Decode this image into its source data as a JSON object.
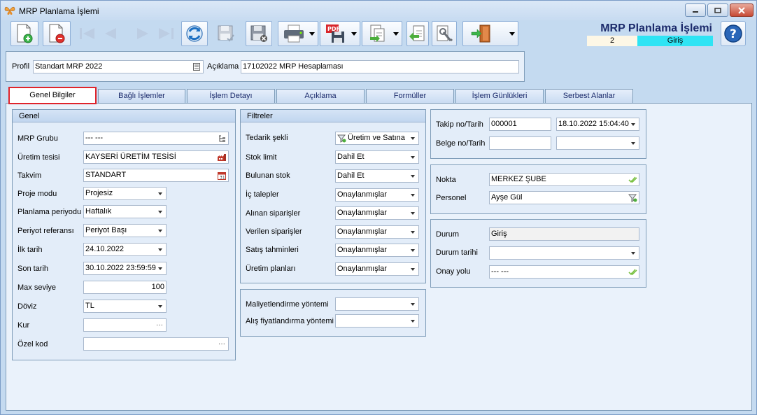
{
  "window": {
    "title": "MRP Planlama İşlemi"
  },
  "header": {
    "title": "MRP Planlama İşlemi",
    "record_no": "2",
    "status": "Giriş"
  },
  "profile": {
    "profile_label": "Profil",
    "profile_value": "Standart MRP 2022",
    "desc_label": "Açıklama",
    "desc_value": "17102022 MRP Hesaplaması"
  },
  "tabs": [
    {
      "label": "Genel Bilgiler"
    },
    {
      "label": "Bağlı İşlemler"
    },
    {
      "label": "İşlem Detayı"
    },
    {
      "label": "Açıklama"
    },
    {
      "label": "Formüller"
    },
    {
      "label": "İşlem Günlükleri"
    },
    {
      "label": "Serbest Alanlar"
    }
  ],
  "genel": {
    "title": "Genel",
    "fields": [
      {
        "label": "MRP Grubu",
        "value": "--- ---"
      },
      {
        "label": "Üretim tesisi",
        "value": "KAYSERİ ÜRETİM TESİSİ"
      },
      {
        "label": "Takvim",
        "value": "STANDART"
      },
      {
        "label": "Proje modu",
        "value": "Projesiz"
      },
      {
        "label": "Planlama periyodu",
        "value": "Haftalık"
      },
      {
        "label": "Periyot referansı",
        "value": "Periyot Başı"
      },
      {
        "label": "İlk tarih",
        "value": "24.10.2022"
      },
      {
        "label": "Son tarih",
        "value": "30.10.2022 23:59:59"
      },
      {
        "label": "Max seviye",
        "value": "100"
      },
      {
        "label": "Döviz",
        "value": "TL"
      },
      {
        "label": "Kur",
        "value": ""
      },
      {
        "label": "Özel kod",
        "value": ""
      }
    ]
  },
  "filtreler": {
    "title": "Filtreler",
    "fields": [
      {
        "label": "Tedarik şekli",
        "value": "Üretim ve Satına"
      },
      {
        "label": "Stok limit",
        "value": "Dahil Et"
      },
      {
        "label": "Bulunan stok",
        "value": "Dahil Et"
      },
      {
        "label": "İç talepler",
        "value": "Onaylanmışlar"
      },
      {
        "label": "Alınan siparişler",
        "value": "Onaylanmışlar"
      },
      {
        "label": "Verilen siparişler",
        "value": "Onaylanmışlar"
      },
      {
        "label": "Satış tahminleri",
        "value": "Onaylanmışlar"
      },
      {
        "label": "Üretim planları",
        "value": "Onaylanmışlar"
      }
    ]
  },
  "maliyet": {
    "fields": [
      {
        "label": "Maliyetlendirme yöntemi",
        "value": ""
      },
      {
        "label": "Alış fiyatlandırma yöntemi",
        "value": ""
      }
    ]
  },
  "takip": {
    "takip_label": "Takip no/Tarih",
    "takip_no": "000001",
    "takip_date": "18.10.2022 15:04:40",
    "belge_label": "Belge no/Tarih",
    "belge_no": "",
    "belge_date": ""
  },
  "nokta": {
    "nokta_label": "Nokta",
    "nokta_value": "MERKEZ ŞUBE",
    "personel_label": "Personel",
    "personel_value": "Ayşe Gül"
  },
  "durum": {
    "durum_label": "Durum",
    "durum_value": "Giriş",
    "durum_tarihi_label": "Durum tarihi",
    "durum_tarihi_value": "",
    "onay_label": "Onay yolu",
    "onay_value": "--- ---"
  },
  "colors": {
    "accent": "#1b2a6b",
    "status_bg": "#2fe4f4",
    "active_tab_border": "#e0242b"
  }
}
